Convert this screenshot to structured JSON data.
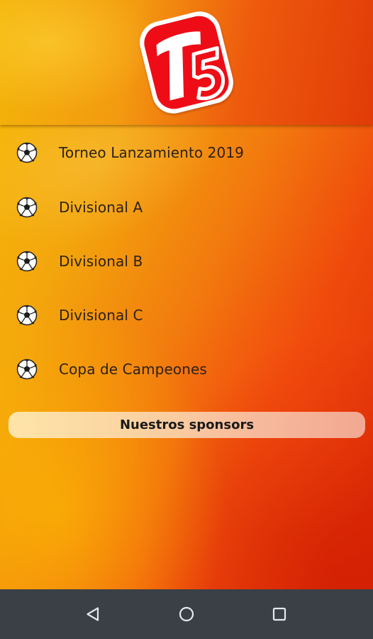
{
  "header": {
    "logo_text": "T5",
    "logo_colors": {
      "primary": "#ee0f16",
      "secondary": "#ffffff"
    }
  },
  "menu": {
    "items": [
      {
        "label": "Torneo Lanzamiento 2019",
        "icon": "soccer-ball-icon"
      },
      {
        "label": "Divisional A",
        "icon": "soccer-ball-icon"
      },
      {
        "label": "Divisional B",
        "icon": "soccer-ball-icon"
      },
      {
        "label": "Divisional C",
        "icon": "soccer-ball-icon"
      },
      {
        "label": "Copa de Campeones",
        "icon": "soccer-ball-icon"
      }
    ]
  },
  "sponsors": {
    "label": "Nuestros sponsors"
  },
  "navbar": {
    "buttons": [
      {
        "name": "back",
        "icon": "back-triangle-icon"
      },
      {
        "name": "home",
        "icon": "home-circle-icon"
      },
      {
        "name": "recents",
        "icon": "recents-square-icon"
      }
    ]
  },
  "colors": {
    "background_start": "#f6bd08",
    "background_end": "#de2a06",
    "navbar": "#3a4046"
  }
}
